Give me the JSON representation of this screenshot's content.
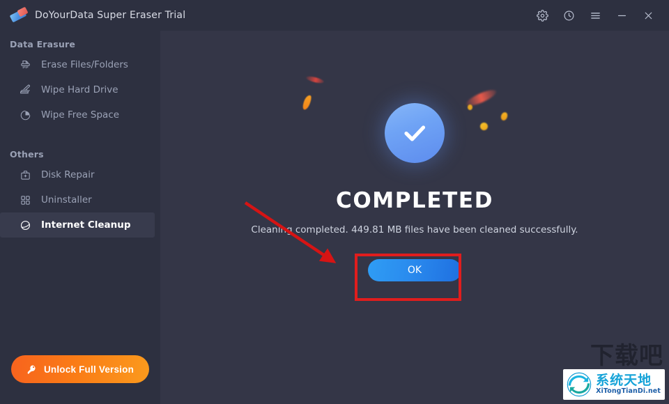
{
  "window": {
    "title": "DoYourData Super Eraser Trial",
    "app_icon": "eraser-icon",
    "controls": [
      {
        "name": "settings-button",
        "icon": "gear-icon"
      },
      {
        "name": "history-button",
        "icon": "clock-icon"
      },
      {
        "name": "menu-button",
        "icon": "hamburger-icon"
      },
      {
        "name": "minimize-button",
        "icon": "minimize-icon"
      },
      {
        "name": "close-button",
        "icon": "close-icon"
      }
    ]
  },
  "sidebar": {
    "sections": [
      {
        "title": "Data Erasure",
        "items": [
          {
            "label": "Erase Files/Folders",
            "icon": "shredder-icon",
            "active": false
          },
          {
            "label": "Wipe Hard Drive",
            "icon": "wipe-drive-icon",
            "active": false
          },
          {
            "label": "Wipe Free Space",
            "icon": "pie-chart-icon",
            "active": false
          }
        ]
      },
      {
        "title": "Others",
        "items": [
          {
            "label": "Disk Repair",
            "icon": "toolbox-icon",
            "active": false
          },
          {
            "label": "Uninstaller",
            "icon": "grid-squares-icon",
            "active": false
          },
          {
            "label": "Internet Cleanup",
            "icon": "globe-icon",
            "active": true
          }
        ]
      }
    ],
    "unlock_button": {
      "label": "Unlock Full Version",
      "icon": "key-icon"
    }
  },
  "main": {
    "status_icon": "check-circle-icon",
    "heading": "COMPLETED",
    "message": "Cleaning completed. 449.81 MB files have been cleaned successfully.",
    "ok_button": "OK",
    "cleaned_size": "449.81 MB"
  },
  "annotations": {
    "arrow": "red-arrow-pointing-to-ok-button",
    "highlight_box": "red-rectangle-around-ok-button"
  },
  "watermark": {
    "background_text": "下载吧",
    "logo_cn": "系统天地",
    "logo_en": "XiTongTianDi.net"
  },
  "colors": {
    "window_bg": "#343647",
    "sidebar_bg": "#2d3040",
    "accent_blue": "#2a8bee",
    "accent_orange": "#f7631e",
    "annotation_red": "#e01d1d",
    "check_circle": "#6fa3f5"
  }
}
